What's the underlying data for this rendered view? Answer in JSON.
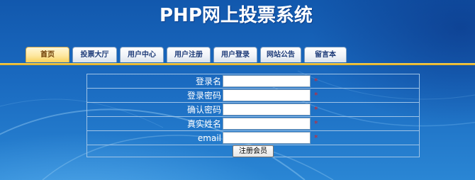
{
  "header": {
    "title": "PHP网上投票系统"
  },
  "nav": {
    "tabs": [
      {
        "label": "首页",
        "active": true
      },
      {
        "label": "投票大厅",
        "active": false
      },
      {
        "label": "用户中心",
        "active": false
      },
      {
        "label": "用户注册",
        "active": false
      },
      {
        "label": "用户登录",
        "active": false
      },
      {
        "label": "网站公告",
        "active": false
      },
      {
        "label": "留言本",
        "active": false
      }
    ]
  },
  "form": {
    "fields": [
      {
        "label": "登录名",
        "value": "",
        "required_mark": "*"
      },
      {
        "label": "登录密码",
        "value": "",
        "required_mark": "*"
      },
      {
        "label": "确认密码",
        "value": "",
        "required_mark": "*"
      },
      {
        "label": "真实姓名",
        "value": "",
        "required_mark": "*"
      },
      {
        "label": "email",
        "value": "",
        "required_mark": "*"
      }
    ],
    "submit_label": "注册会员"
  },
  "colors": {
    "background": "#1a68b8",
    "active_tab": "#fde7a0",
    "nav_bar": "#f9d55a",
    "required_mark": "#e02020"
  }
}
